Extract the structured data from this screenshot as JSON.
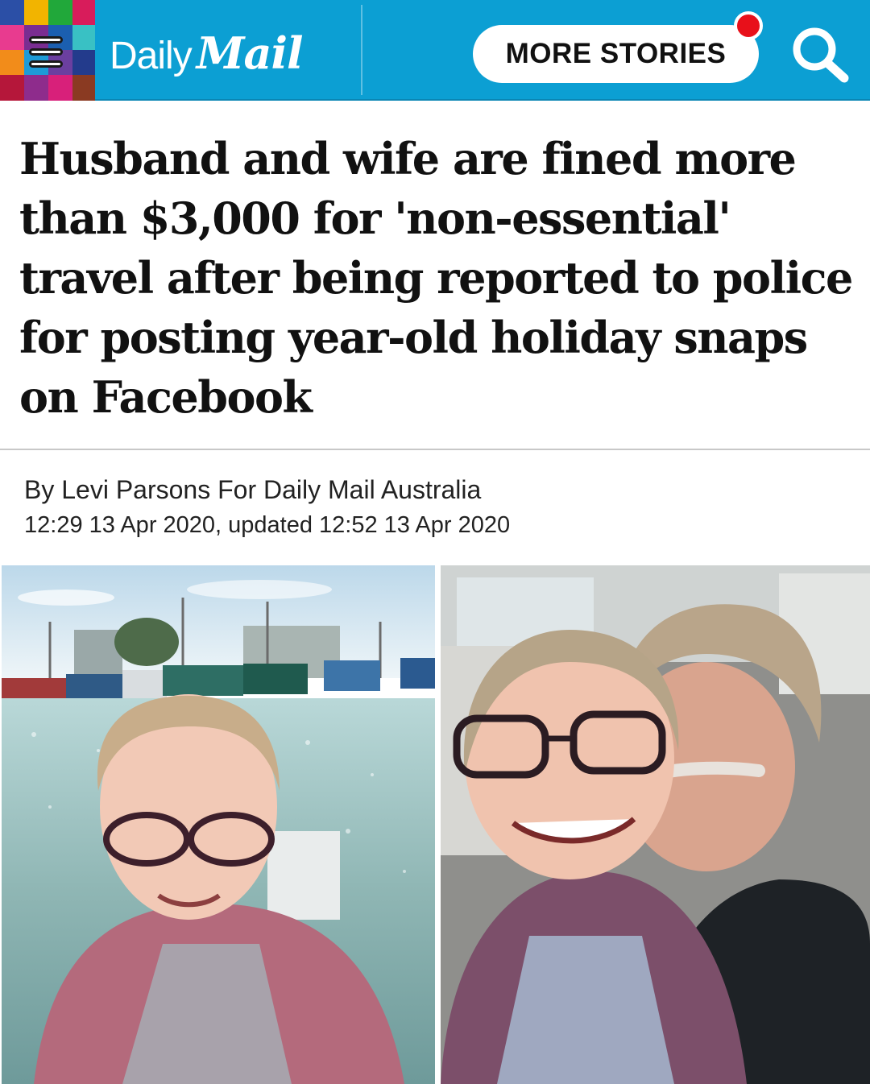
{
  "header": {
    "brand_daily": "Daily",
    "brand_mail": "Mail",
    "more_stories_label": "MORE STORIES",
    "background_color": "#0c9fd3",
    "notification_color": "#e8101a",
    "icons": {
      "menu": "menu-icon",
      "search": "search-icon"
    }
  },
  "article": {
    "headline": "Husband and wife are fined more than $3,000 for 'non-essential' travel after being reported to police for posting year-old holiday snaps on Facebook",
    "byline": "By Levi Parsons For Daily Mail Australia",
    "dateline": "12:29 13 Apr 2020, updated 12:52 13 Apr 2020"
  },
  "photos": {
    "left_alt": "Woman taking a selfie in front of a harbour with fishing boats",
    "right_alt": "Woman and man taking a selfie inside a car"
  }
}
